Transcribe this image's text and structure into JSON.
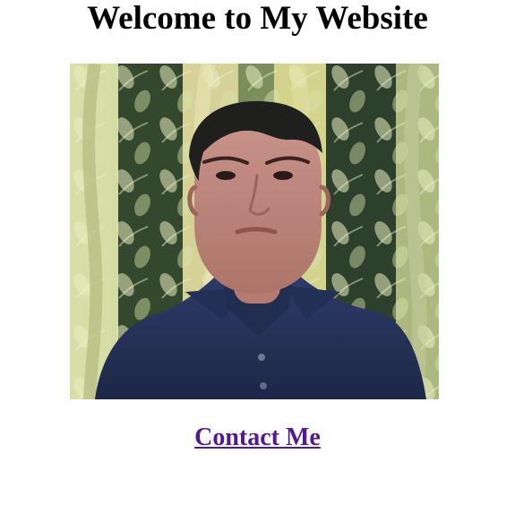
{
  "page": {
    "title": "Welcome to My Website"
  },
  "photo": {
    "alt": "Portrait photo"
  },
  "contact": {
    "label": "Contact Me",
    "link_color": "#551a8b"
  }
}
